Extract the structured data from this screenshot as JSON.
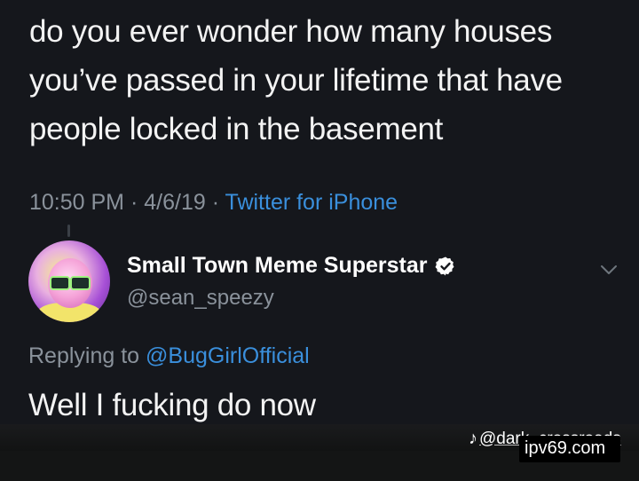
{
  "tweet": {
    "text": "do you ever wonder how many houses you’ve passed in your lifetime that have people locked in the basement",
    "time": "10:50 PM",
    "date": "4/6/19",
    "separator": "·",
    "client": "Twitter for iPhone"
  },
  "reply": {
    "display_name": "Small Town Meme Superstar",
    "handle": "@sean_speezy",
    "replying_prefix": "Replying to",
    "replying_to": "@BugGirlOfficial",
    "text": "Well I fucking do now"
  },
  "watermarks": {
    "tiktok_user": "@dark_crossroads",
    "site": "ipv69.com"
  },
  "colors": {
    "background": "#15171c",
    "link": "#3a8fdc",
    "muted": "#8a929b",
    "text": "#f3f3f3"
  },
  "icons": [
    "verified-badge-icon",
    "chevron-down-icon",
    "tiktok-icon"
  ]
}
